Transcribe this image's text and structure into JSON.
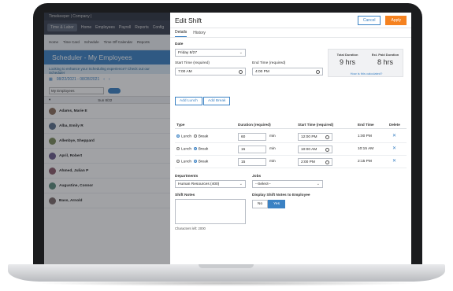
{
  "background_app": {
    "topbar_title": "Timekeeper | Company |",
    "nav_items": [
      "Time & Labor",
      "Home",
      "Employees",
      "Payroll",
      "Reports",
      "Config"
    ],
    "sub_items": [
      "Home",
      "Time Card",
      "Schedule",
      "Time Off Calendar",
      "Reports"
    ],
    "page_title": "Scheduler - My Employees",
    "banner": "Looking to enhance your Scheduling experience? Check out our Scheduler",
    "date_range": "08/22/2021 - 08/28/2021",
    "filter_value": "My Employees",
    "day_header": "Sun 8/22",
    "employees": [
      {
        "name": "Adams, Marie E",
        "sub": ""
      },
      {
        "name": "Alba, Emily R",
        "sub": ""
      },
      {
        "name": "Allenbye, Sheppard",
        "sub": ""
      },
      {
        "name": "April, Robert",
        "sub": ""
      },
      {
        "name": "Ahmed, Julian P",
        "sub": ""
      },
      {
        "name": "Augustine, Connor",
        "sub": ""
      },
      {
        "name": "Bass, Arnold",
        "sub": ""
      }
    ]
  },
  "panel": {
    "title": "Edit Shift",
    "cancel_label": "Cancel",
    "apply_label": "Apply",
    "tabs": [
      "Details",
      "History"
    ],
    "date_label": "Date",
    "date_value": "Friday 8/27",
    "start_label": "Start Time (required)",
    "start_value": "7:00 AM",
    "end_label": "End Time (required)",
    "end_value": "4:00 PM",
    "summary": {
      "total_caption": "Total Duration",
      "total_value": "9 hrs",
      "paid_caption": "Est. Paid Duration",
      "paid_value": "8 hrs",
      "link": "How is this calculated?"
    },
    "add_lunch_label": "Add Lunch",
    "add_break_label": "Add Break",
    "table_headers": [
      "Type",
      "Duration (required)",
      "Start Time (required)",
      "End Time",
      "Delete"
    ],
    "type_options": [
      "Lunch",
      "Break"
    ],
    "unit": "min",
    "rows": [
      {
        "selected": "Lunch",
        "duration": "60",
        "start": "12:00 PM",
        "end": "1:00 PM"
      },
      {
        "selected": "Break",
        "duration": "15",
        "start": "10:00 AM",
        "end": "10:15 AM"
      },
      {
        "selected": "Break",
        "duration": "15",
        "start": "2:00 PM",
        "end": "2:15 PM"
      }
    ],
    "departments_label": "Departments",
    "departments_value": "Human Resources (400)",
    "jobs_label": "Jobs",
    "jobs_value": "--Select--",
    "notes_label": "Shift Notes",
    "chars_left": "Characters left: 2000",
    "display_notes_label": "Display Shift Notes to Employee",
    "display_options": [
      "No",
      "Yes"
    ]
  },
  "colors": {
    "accent": "#3b82c4",
    "apply": "#f58220",
    "laptop": "#1b1c1e"
  }
}
